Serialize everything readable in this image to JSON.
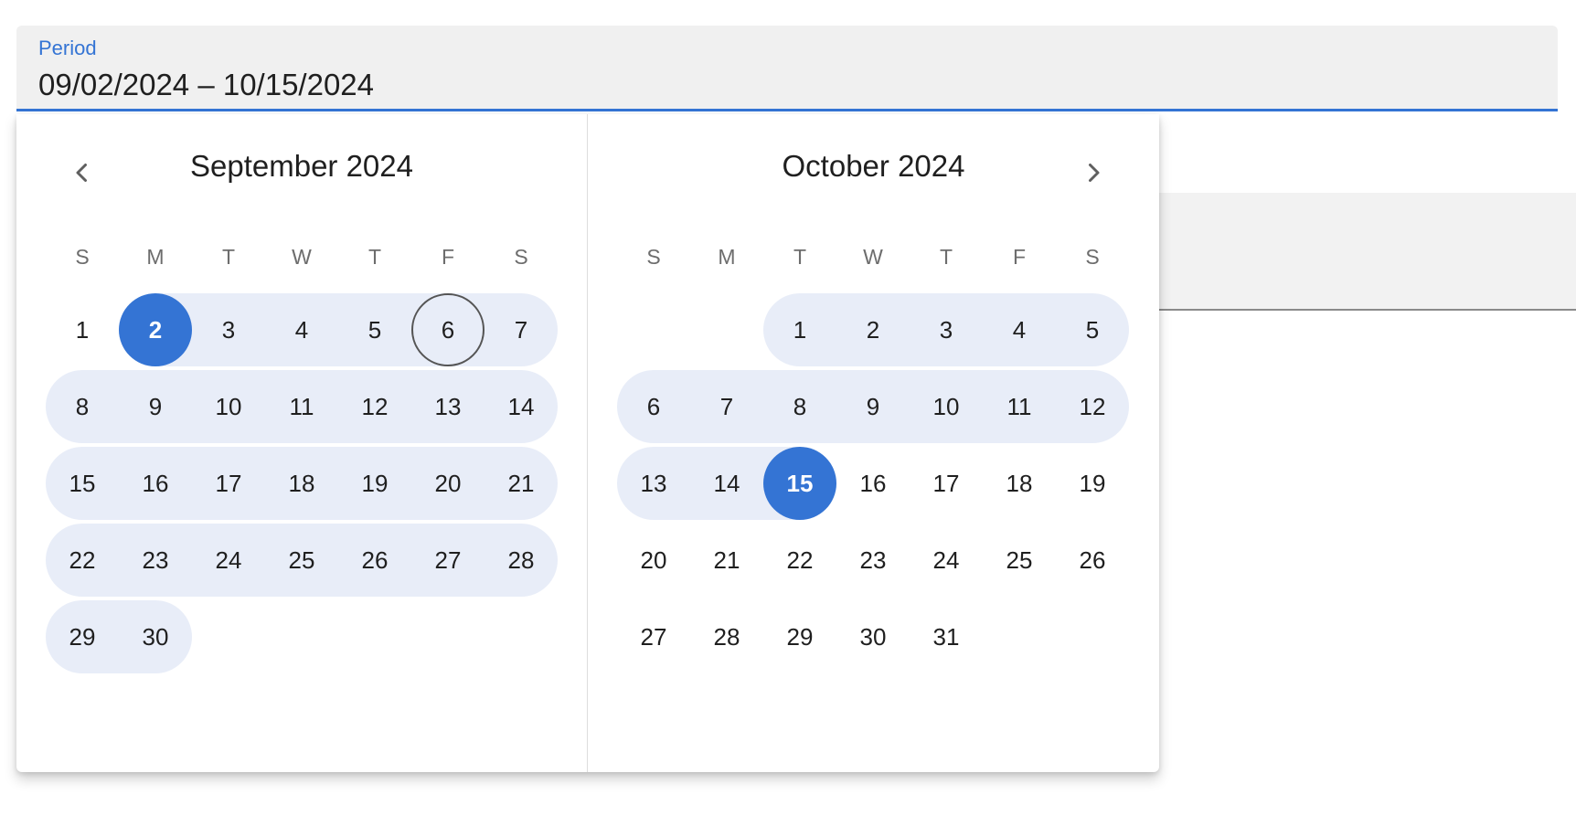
{
  "field": {
    "label": "Period",
    "value": "09/02/2024 – 10/15/2024"
  },
  "colors": {
    "accent": "#3474d4",
    "range_band": "#e8edf8",
    "field_bg": "#f0f0f0"
  },
  "icons": {
    "prev": "chevron-left-icon",
    "next": "chevron-right-icon"
  },
  "weekdays": [
    "S",
    "M",
    "T",
    "W",
    "T",
    "F",
    "S"
  ],
  "months": [
    {
      "title": "September 2024",
      "first_weekday": 0,
      "days_in_month": 30,
      "range_start": 2,
      "range_end": 30,
      "selected": [
        2
      ],
      "today": 6
    },
    {
      "title": "October 2024",
      "first_weekday": 2,
      "days_in_month": 31,
      "range_start": 1,
      "range_end": 15,
      "selected": [
        15
      ],
      "today": null
    }
  ]
}
